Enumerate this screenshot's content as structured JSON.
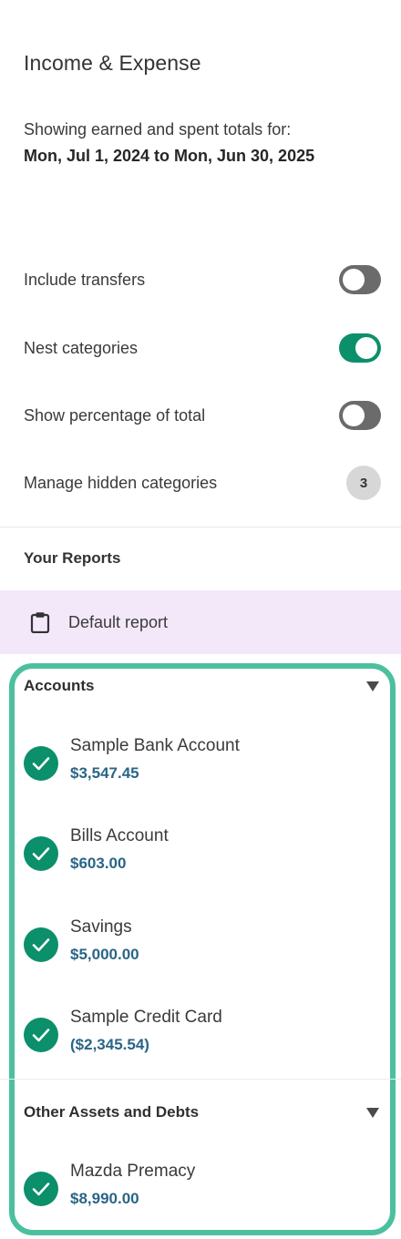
{
  "header": {
    "title": "Income & Expense",
    "range_lead": "Showing earned and spent totals for:",
    "range_dates": "Mon, Jul 1, 2024 to Mon, Jun 30, 2025"
  },
  "options": {
    "include_transfers": {
      "label": "Include transfers",
      "enabled": false
    },
    "nest_categories": {
      "label": "Nest categories",
      "enabled": true
    },
    "show_percentage": {
      "label": "Show percentage of total",
      "enabled": false
    },
    "hidden_categories": {
      "label": "Manage hidden categories",
      "count": "3"
    }
  },
  "reports": {
    "heading": "Your Reports",
    "items": [
      {
        "label": "Default report",
        "icon": "clipboard-icon"
      }
    ]
  },
  "accounts_section": {
    "label": "Accounts",
    "items": [
      {
        "name": "Sample Bank Account",
        "amount": "$3,547.45",
        "checked": true
      },
      {
        "name": "Bills Account",
        "amount": "$603.00",
        "checked": true
      },
      {
        "name": "Savings",
        "amount": "$5,000.00",
        "checked": true
      },
      {
        "name": "Sample Credit Card",
        "amount": "($2,345.54)",
        "checked": true
      }
    ]
  },
  "other_section": {
    "label": "Other Assets and Debts",
    "items": [
      {
        "name": "Mazda Premacy",
        "amount": "$8,990.00",
        "checked": true
      }
    ]
  },
  "colors": {
    "accent_green": "#0c8f6b",
    "panel_border": "#4cc09e",
    "amount_blue": "#2a6586",
    "report_highlight": "#f3e8f9"
  }
}
